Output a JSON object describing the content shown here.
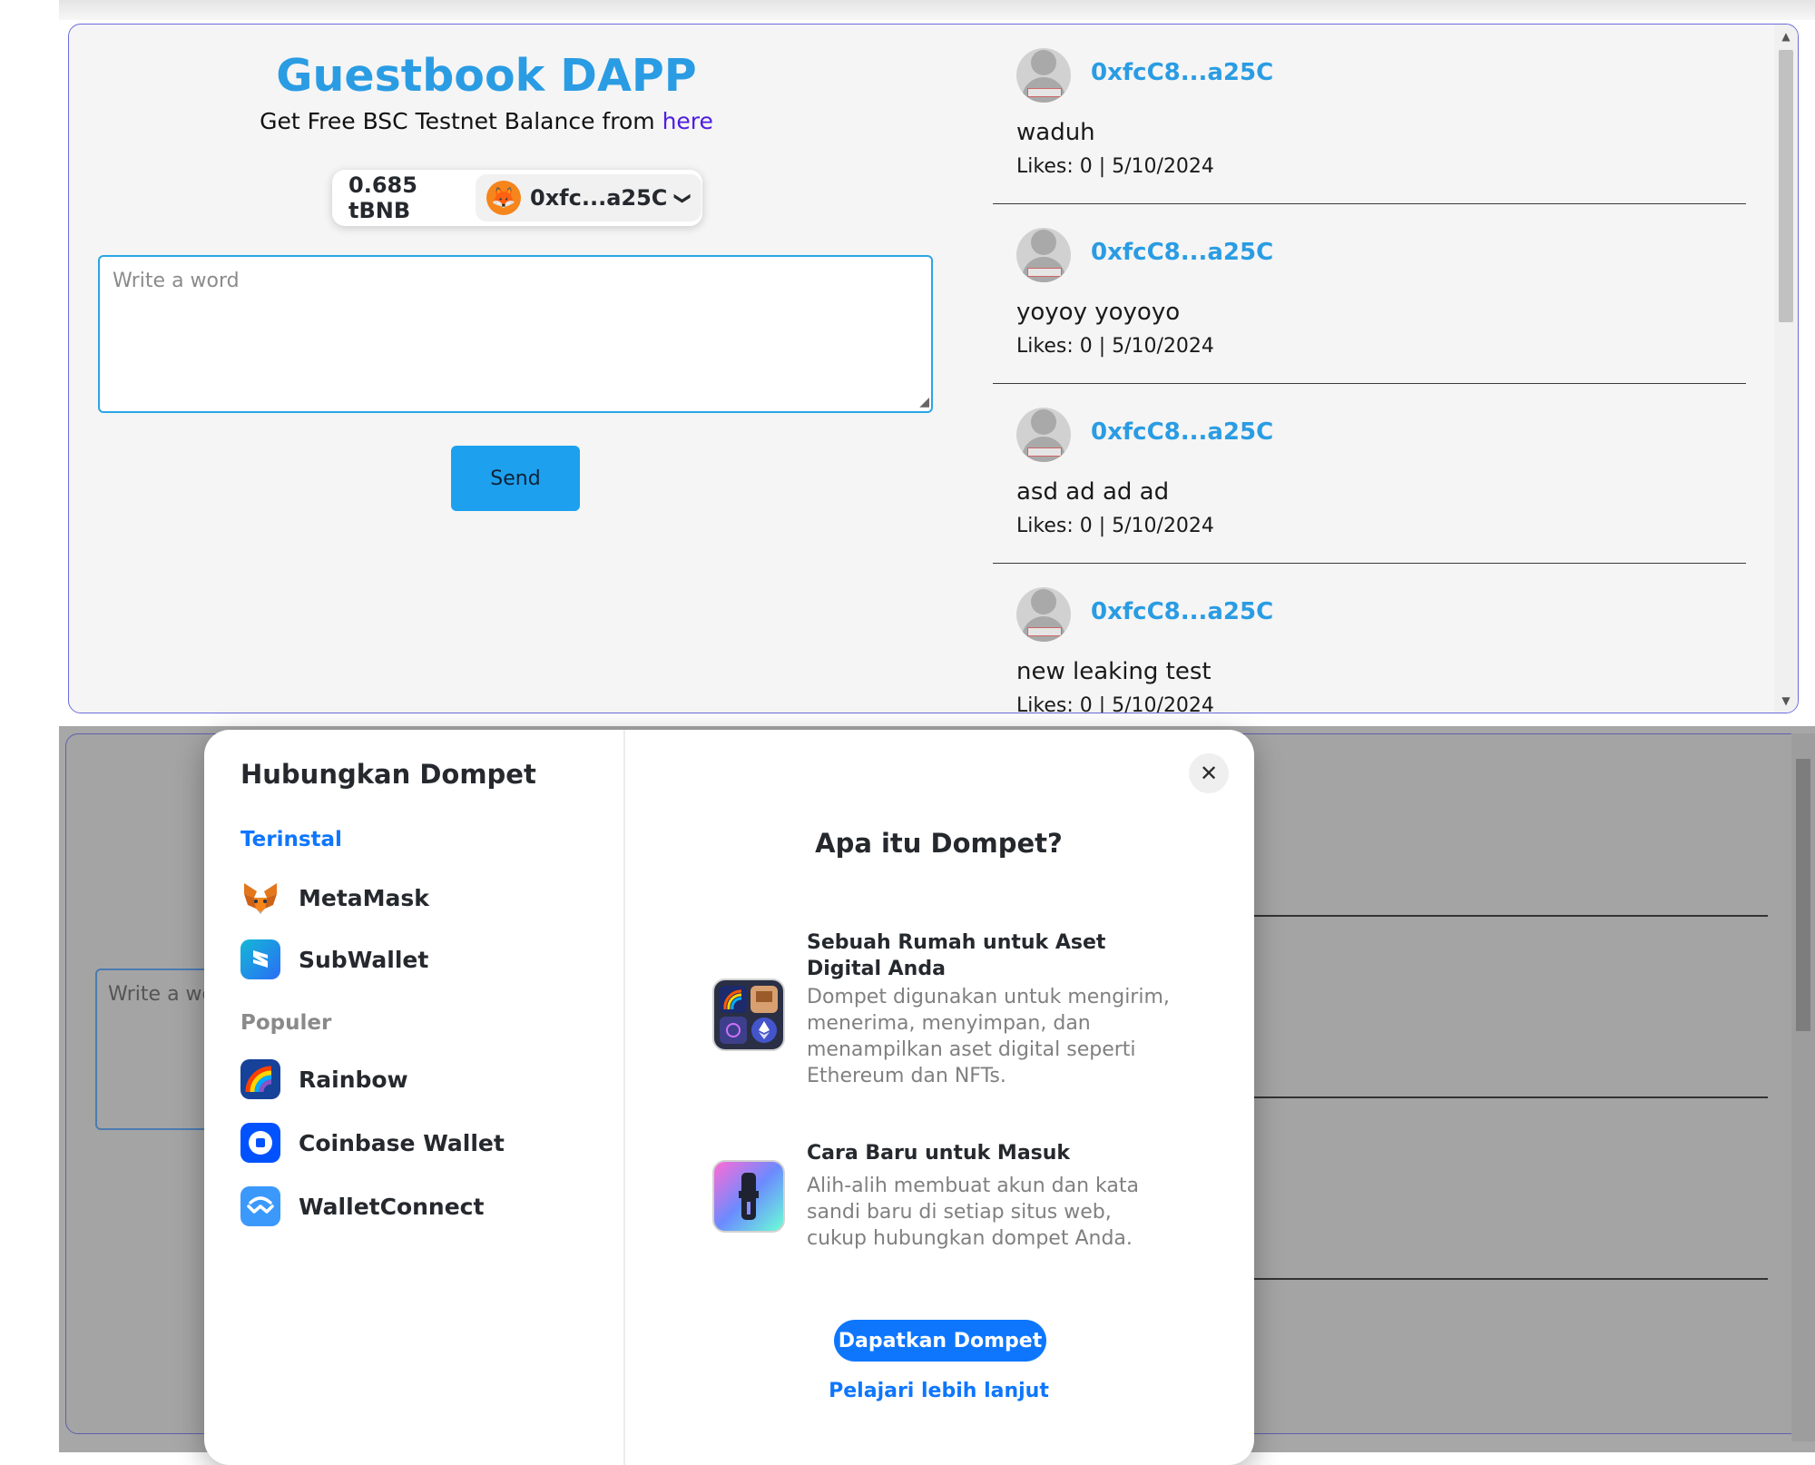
{
  "app": {
    "title": "Guestbook DAPP",
    "subtitle_prefix": "Get Free BSC Testnet Balance from ",
    "subtitle_link": "here"
  },
  "wallet": {
    "balance": "0.685 tBNB",
    "account": "0xfc...a25C",
    "chevron": "❯"
  },
  "composer": {
    "placeholder": "Write a word",
    "send_label": "Send"
  },
  "messages": [
    {
      "address": "0xfcC8...a25C",
      "text": "waduh",
      "meta": "Likes: 0 | 5/10/2024"
    },
    {
      "address": "0xfcC8...a25C",
      "text": "yoyoy yoyoyo",
      "meta": "Likes: 0 | 5/10/2024"
    },
    {
      "address": "0xfcC8...a25C",
      "text": "asd ad ad ad",
      "meta": "Likes: 0 | 5/10/2024"
    },
    {
      "address": "0xfcC8...a25C",
      "text": "new leaking test",
      "meta": "Likes: 0 | 5/10/2024"
    }
  ],
  "dimmed": {
    "placeholder_partial": "Write a wo"
  },
  "modal": {
    "title": "Hubungkan Dompet",
    "installed_label": "Terinstal",
    "popular_label": "Populer",
    "installed": [
      {
        "name": "MetaMask",
        "icon": "metamask-icon"
      },
      {
        "name": "SubWallet",
        "icon": "subwallet-icon"
      }
    ],
    "popular": [
      {
        "name": "Rainbow",
        "icon": "rainbow-icon"
      },
      {
        "name": "Coinbase Wallet",
        "icon": "coinbase-icon"
      },
      {
        "name": "WalletConnect",
        "icon": "walletconnect-icon"
      }
    ],
    "close_glyph": "✕",
    "info_title": "Apa itu Dompet?",
    "features": [
      {
        "title": "Sebuah Rumah untuk Aset Digital Anda",
        "desc": "Dompet digunakan untuk mengirim, menerima, menyimpan, dan menampilkan aset digital seperti Ethereum dan NFTs."
      },
      {
        "title": "Cara Baru untuk Masuk",
        "desc": "Alih-alih membuat akun dan kata sandi baru di setiap situs web, cukup hubungkan dompet Anda."
      }
    ],
    "cta": "Dapatkan Dompet",
    "learn_more": "Pelajari lebih lanjut"
  },
  "colors": {
    "accent": "#2a9ce3",
    "link": "#4f1de0",
    "send_button": "#1da1ee",
    "rainbowkit_blue": "#0e76fd",
    "metamask_orange": "#f6851b",
    "coinbase_blue": "#0052ff",
    "walletconnect_blue": "#3b99fc"
  }
}
